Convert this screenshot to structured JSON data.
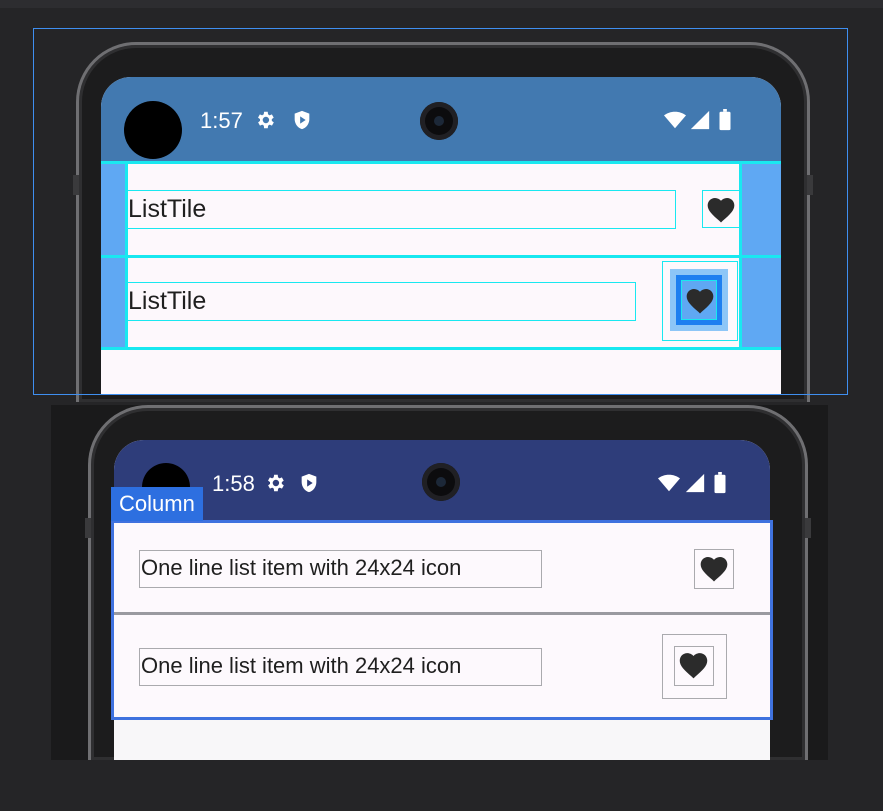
{
  "top_preview": {
    "status_time": "1:57",
    "status_bar_color": "#4279b0",
    "tiles": [
      {
        "title": "ListTile",
        "icon": "heart-icon"
      },
      {
        "title": "ListTile",
        "icon": "heart-icon",
        "selected": true
      }
    ],
    "overlay_colors": {
      "bounds": "#19e8f0",
      "padding": "#5fa8f3",
      "selection": "#3f8ff0"
    }
  },
  "bottom_preview": {
    "status_time": "1:58",
    "status_bar_color": "#2e3d7a",
    "selection_label": "Column",
    "items": [
      {
        "text": "One line list item with 24x24 icon",
        "icon": "heart-icon"
      },
      {
        "text": "One line list item with 24x24 icon",
        "icon": "heart-icon"
      }
    ],
    "overlay_colors": {
      "selection": "#3f72df",
      "bounds": "#aaaaae"
    }
  },
  "status_icons": [
    "settings-icon",
    "shield-icon",
    "wifi-icon",
    "signal-icon",
    "battery-icon"
  ]
}
